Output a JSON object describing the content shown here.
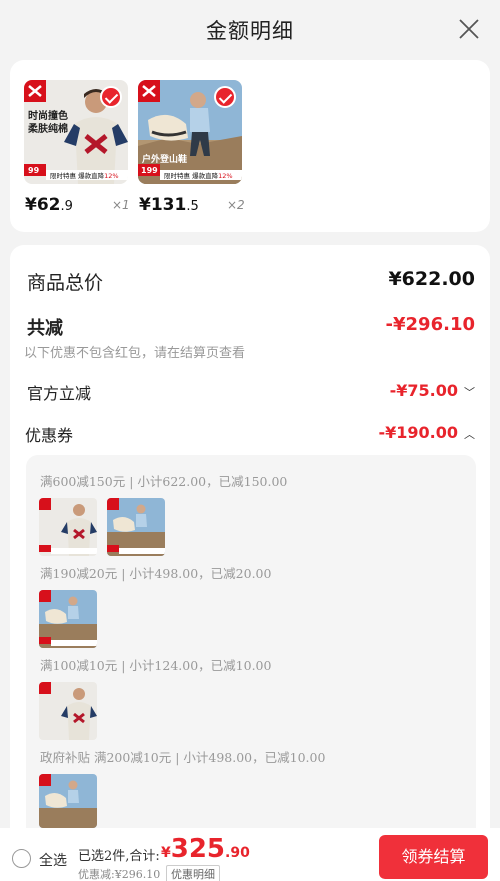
{
  "header": {
    "title": "金额明细"
  },
  "products": [
    {
      "tag1": "时尚撞色",
      "tag2": "柔肤纯棉",
      "badge": "99",
      "promo": "限时特惠 爆款直降",
      "pct": "12%",
      "price_int": "¥62",
      "price_dec": ".9",
      "qty": "×1"
    },
    {
      "tag1": "户外登山鞋",
      "tag2": "",
      "badge": "199",
      "promo": "限时特惠 爆款直降",
      "pct": "12%",
      "price_int": "¥131",
      "price_dec": ".5",
      "qty": "×2"
    }
  ],
  "summary": {
    "total_label": "商品总价",
    "total_value": "¥622.00",
    "discount_label": "共减",
    "discount_value": "-¥296.10",
    "discount_note": "以下优惠不包含红包，请在结算页查看",
    "official_label": "官方立减",
    "official_value": "-¥75.00",
    "coupon_label": "优惠券",
    "coupon_value": "-¥190.00"
  },
  "coupons": [
    {
      "text": "满600减150元 | 小计622.00，已减150.00"
    },
    {
      "text": "满190减20元 | 小计498.00，已减20.00"
    },
    {
      "text": "满100减10元 | 小计124.00，已减10.00"
    },
    {
      "text": "政府补贴 满200减10元 | 小计498.00，已减10.00"
    }
  ],
  "bottom": {
    "select_all": "全选",
    "selected_prefix": "已选2件,合计:",
    "price_sym": "¥",
    "price_int": "325",
    "price_dec": ".90",
    "discounted": "优惠减:¥296.10",
    "detail_btn": "优惠明细",
    "checkout": "领券结算"
  },
  "colors": {
    "accent": "#e8242c",
    "button": "#f0303a"
  }
}
